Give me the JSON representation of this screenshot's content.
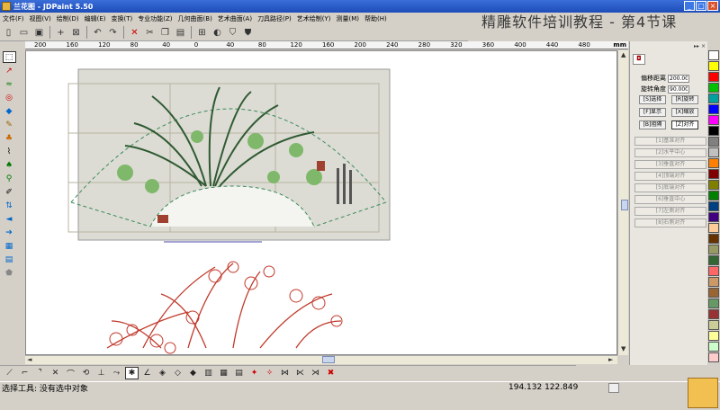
{
  "window": {
    "title": "兰花图 - JDPaint 5.50"
  },
  "menu": [
    "文件(F)",
    "视图(V)",
    "绘制(D)",
    "编辑(E)",
    "变换(T)",
    "专业功能(Z)",
    "几何曲面(B)",
    "艺术曲面(A)",
    "刀具路径(P)",
    "艺术绘制(Y)",
    "测量(M)",
    "帮助(H)"
  ],
  "overlay_title": "精雕软件培训教程 - 第4节课",
  "toolbar_icons": [
    "new-icon",
    "open-icon",
    "save-icon",
    "crosshair-icon",
    "grid-icon",
    "undo-icon",
    "redo-icon",
    "delete-icon",
    "cut-icon",
    "copy-icon",
    "paste-icon",
    "layer-icon",
    "fill-icon",
    "shield-icon",
    "shield-icon"
  ],
  "ruler": {
    "labels": [
      "200",
      "160",
      "120",
      "80",
      "40",
      "0",
      "40",
      "80",
      "120",
      "160",
      "200",
      "240",
      "280",
      "320",
      "360",
      "400",
      "440",
      "480"
    ],
    "unit": "mm"
  },
  "panel": {
    "offset_label": "偏移距离",
    "offset_value": "200.00",
    "angle_label": "旋转角度",
    "angle_value": "90.000",
    "buttons": [
      "[S]选择",
      "[R]旋转",
      "[F]显示",
      "[X]缩放",
      "[B]阻隔",
      "[Z]对齐"
    ],
    "grayed": [
      "[1]基准对齐",
      "[2]水平中心",
      "[3]垂直对齐",
      "[4]顶端对齐",
      "[5]底端对齐",
      "[6]垂直中心",
      "[7]左侧对齐",
      "[8]右侧对齐"
    ]
  },
  "palette_colors": [
    "#ffffff",
    "#ffff00",
    "#ff0000",
    "#00c000",
    "#00a0a0",
    "#0000ff",
    "#ff00ff",
    "#000000",
    "#808080",
    "#c0c0c0",
    "#ff8000",
    "#800000",
    "#808000",
    "#008000",
    "#004080",
    "#400080",
    "#ffcc99",
    "#663300",
    "#999966",
    "#336633",
    "#ff6666",
    "#cc9966",
    "#996633",
    "#669966",
    "#993333",
    "#cccc99",
    "#ffff99",
    "#ccffcc",
    "#ffcccc"
  ],
  "status": {
    "text": "选择工具: 没有选中对象",
    "coords": "194.132 122.849"
  }
}
